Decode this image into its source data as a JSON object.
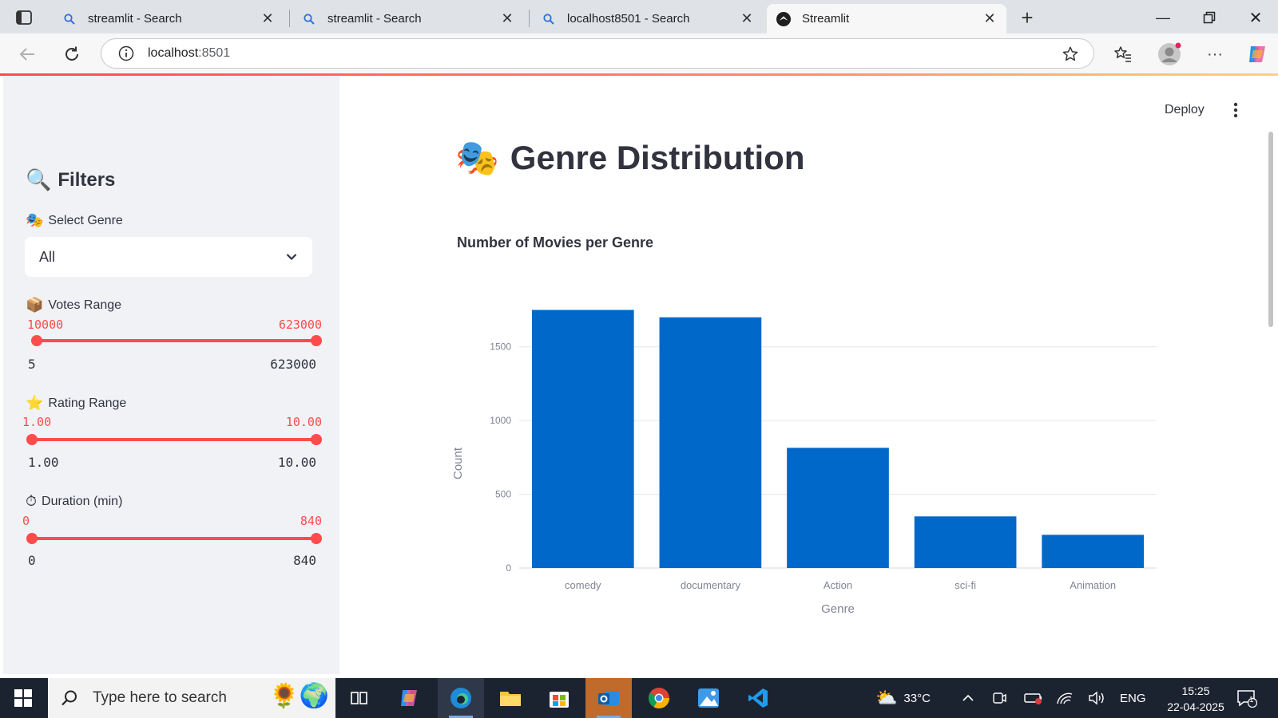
{
  "browser": {
    "tabs": [
      {
        "title": "streamlit - Search",
        "icon": "search-icon"
      },
      {
        "title": "streamlit - Search",
        "icon": "search-icon"
      },
      {
        "title": "localhost8501 - Search",
        "icon": "search-icon"
      },
      {
        "title": "Streamlit",
        "icon": "streamlit-logo-icon",
        "active": true
      }
    ],
    "url_host": "localhost",
    "url_port": ":8501"
  },
  "sidebar": {
    "title": "Filters",
    "title_emoji": "🔍",
    "genre": {
      "label": "Select Genre",
      "emoji": "🎭",
      "value": "All"
    },
    "votes": {
      "label": "Votes Range",
      "emoji": "📦",
      "low": "10000",
      "high": "623000",
      "min": "5",
      "max": "623000",
      "low_frac": 0.016,
      "high_frac": 1.0
    },
    "rating": {
      "label": "Rating Range",
      "emoji": "⭐",
      "low": "1.00",
      "high": "10.00",
      "min": "1.00",
      "max": "10.00",
      "low_frac": 0.0,
      "high_frac": 1.0
    },
    "duration": {
      "label": "Duration (min)",
      "emoji": "⏱",
      "low": "0",
      "high": "840",
      "min": "0",
      "max": "840",
      "low_frac": 0.0,
      "high_frac": 1.0
    }
  },
  "header": {
    "deploy_label": "Deploy"
  },
  "main": {
    "title": "Genre Distribution",
    "title_emoji": "🎭",
    "chart_title": "Number of Movies per Genre"
  },
  "chart_data": {
    "type": "bar",
    "title": "Number of Movies per Genre",
    "xlabel": "Genre",
    "ylabel": "Count",
    "categories": [
      "comedy",
      "documentary",
      "Action",
      "sci-fi",
      "Animation"
    ],
    "values": [
      1750,
      1700,
      815,
      350,
      225
    ],
    "ylim": [
      0,
      1850
    ],
    "yticks": [
      0,
      500,
      1000,
      1500
    ],
    "grid": true,
    "bar_color": "#0068c9"
  },
  "taskbar": {
    "search_placeholder": "Type here to search",
    "weather": "33°C",
    "language": "ENG",
    "time": "15:25",
    "date": "22-04-2025",
    "notification_count": "1"
  },
  "colors": {
    "accent": "#ff4b4b",
    "sidebar_bg": "#f0f2f6",
    "text": "#31333f"
  }
}
